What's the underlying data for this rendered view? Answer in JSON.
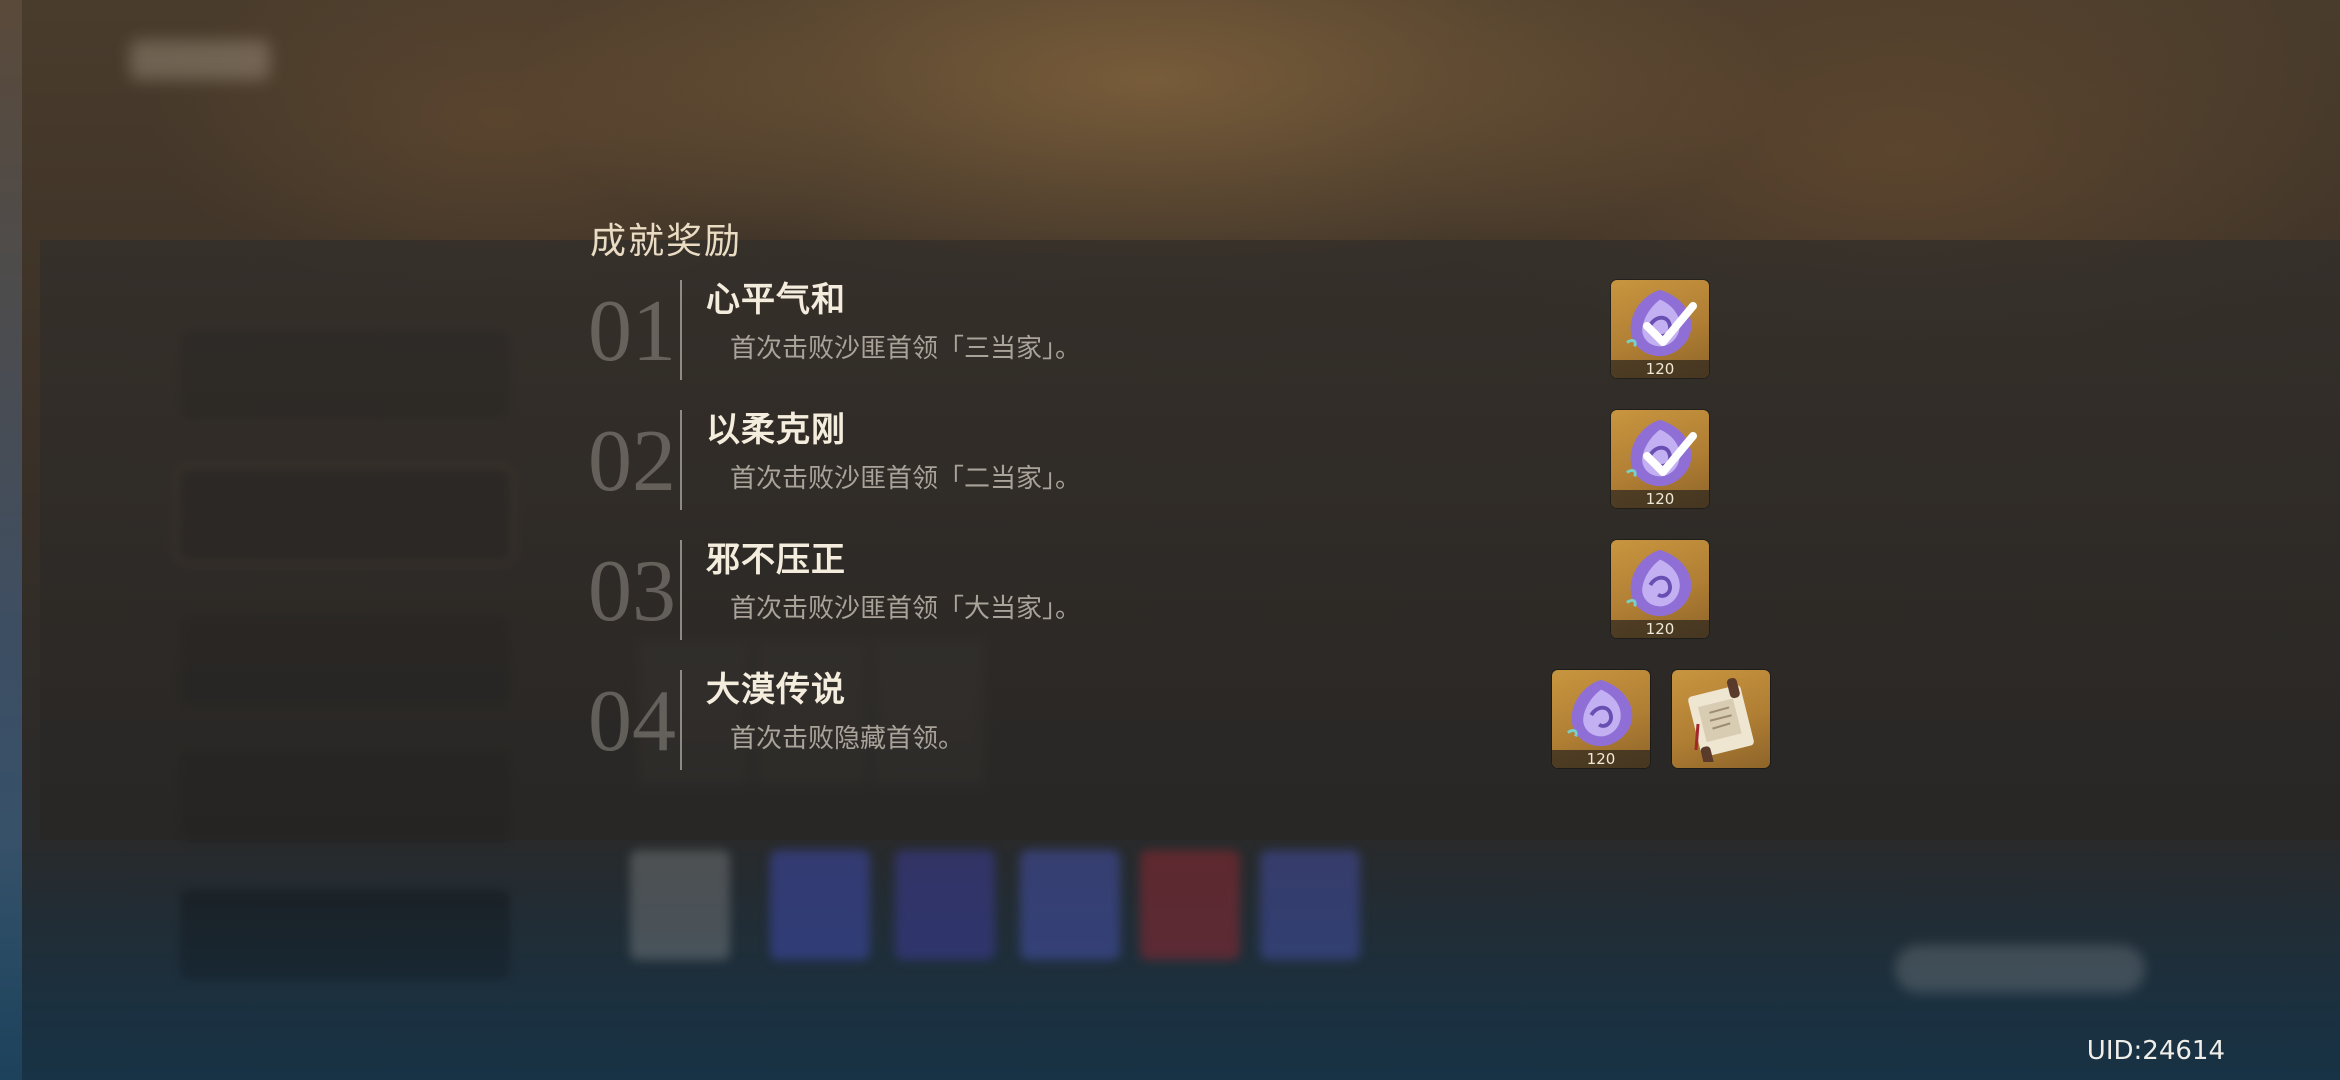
{
  "section_title": "成就奖励",
  "achievements": [
    {
      "number": "01",
      "title": "心平气和",
      "description": "首次击败沙匪首领「三当家」。",
      "rewards": [
        {
          "icon": "primogem-icon",
          "count": "120",
          "claimed": true
        }
      ]
    },
    {
      "number": "02",
      "title": "以柔克刚",
      "description": "首次击败沙匪首领「二当家」。",
      "rewards": [
        {
          "icon": "primogem-icon",
          "count": "120",
          "claimed": true
        }
      ]
    },
    {
      "number": "03",
      "title": "邪不压正",
      "description": "首次击败沙匪首领「大当家」。",
      "rewards": [
        {
          "icon": "primogem-icon",
          "count": "120",
          "claimed": false
        }
      ]
    },
    {
      "number": "04",
      "title": "大漠传说",
      "description": "首次击败隐藏首领。",
      "rewards": [
        {
          "icon": "primogem-icon",
          "count": "120",
          "claimed": false
        },
        {
          "icon": "scroll-namecard-icon",
          "count": "",
          "claimed": false
        }
      ]
    }
  ],
  "uid": "UID:24614",
  "colors": {
    "reward_bg": "#c8953f",
    "gem_purple": "#8f6fd6",
    "title_text": "#f4ecdc"
  }
}
